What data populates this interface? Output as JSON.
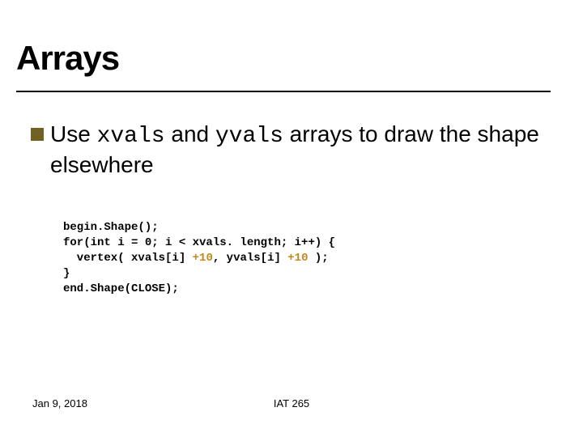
{
  "title": "Arrays",
  "bullet": {
    "pre": "Use ",
    "code1": "xvals",
    "mid": " and ",
    "code2": "yvals",
    "post": " arrays to draw the shape elsewhere"
  },
  "code": {
    "l1": "begin.Shape();",
    "l2": "for(int i = 0; i < xvals. length; i++) {",
    "l3a": "  vertex( xvals[i] ",
    "l3h1": "+10",
    "l3b": ", yvals[i] ",
    "l3h2": "+10",
    "l3c": " );",
    "l4": "}",
    "l5": "end.Shape(CLOSE);"
  },
  "footer": {
    "date": "Jan 9, 2018",
    "course": "IAT 265"
  }
}
